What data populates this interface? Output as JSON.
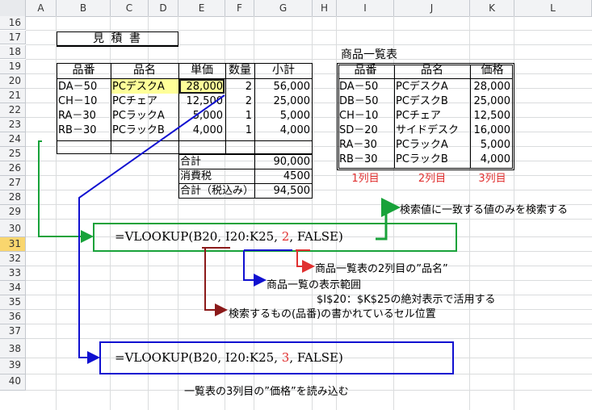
{
  "columns": [
    "A",
    "B",
    "C",
    "D",
    "E",
    "F",
    "G",
    "H",
    "I",
    "J",
    "K",
    "L"
  ],
  "rows": [
    "16",
    "17",
    "18",
    "19",
    "20",
    "21",
    "22",
    "23",
    "24",
    "25",
    "26",
    "27",
    "28",
    "29",
    "30",
    "31",
    "32",
    "33",
    "34",
    "35",
    "36",
    "37",
    "38",
    "39",
    "40"
  ],
  "active_row": "31",
  "quote_title": "見 積 書",
  "quote_table": {
    "headers": [
      "品番",
      "品名",
      "単価",
      "数量",
      "小計"
    ],
    "rows": [
      [
        "DA－50",
        "PCデスクA",
        "28,000",
        "2",
        "56,000"
      ],
      [
        "CH－10",
        "PCチェア",
        "12,500",
        "2",
        "25,000"
      ],
      [
        "RA－30",
        "PCラックA",
        "5,000",
        "1",
        "5,000"
      ],
      [
        "RB－30",
        "PCラックB",
        "4,000",
        "1",
        "4,000"
      ]
    ],
    "summary": [
      {
        "label": "合計",
        "value": "90,000"
      },
      {
        "label": "消費税",
        "value": "4500"
      },
      {
        "label": "合計（税込み）",
        "value": "94,500"
      }
    ]
  },
  "product_list": {
    "title": "商品一覧表",
    "headers": [
      "品番",
      "品名",
      "価格"
    ],
    "rows": [
      [
        "DA－50",
        "PCデスクA",
        "28,000"
      ],
      [
        "DB－50",
        "PCデスクB",
        "25,000"
      ],
      [
        "CH－10",
        "PCチェア",
        "12,500"
      ],
      [
        "SD－20",
        "サイドデスク",
        "16,000"
      ],
      [
        "RA－30",
        "PCラックA",
        "5,000"
      ],
      [
        "RB－30",
        "PCラックB",
        "4,000"
      ]
    ],
    "col_labels": [
      "1列目",
      "2列目",
      "3列目"
    ]
  },
  "formula1": {
    "pre": "=VLOOKUP(B20, I20:K25, ",
    "num": "2",
    "post": ", FALSE)"
  },
  "formula2": {
    "pre": "=VLOOKUP(B20, I20:K25, ",
    "num": "3",
    "post": ", FALSE)"
  },
  "notes": {
    "exact_match": "検索値に一致する値のみを検索する",
    "col2_name": "商品一覧表の2列目の”品名”",
    "range": "商品一覧の表示範囲",
    "absolute": "$I$20：$K$25の絶対表示で活用する",
    "lookup_key": "検索するもの(品番)の書かれているセル位置",
    "col3_price": "一覧表の3列目の”価格”を読み込む"
  },
  "colors": {
    "highlight": "#ffff99",
    "green": "#18a23a",
    "blue": "#1010d0",
    "darkred": "#8b1a1a",
    "red": "#e03030"
  }
}
